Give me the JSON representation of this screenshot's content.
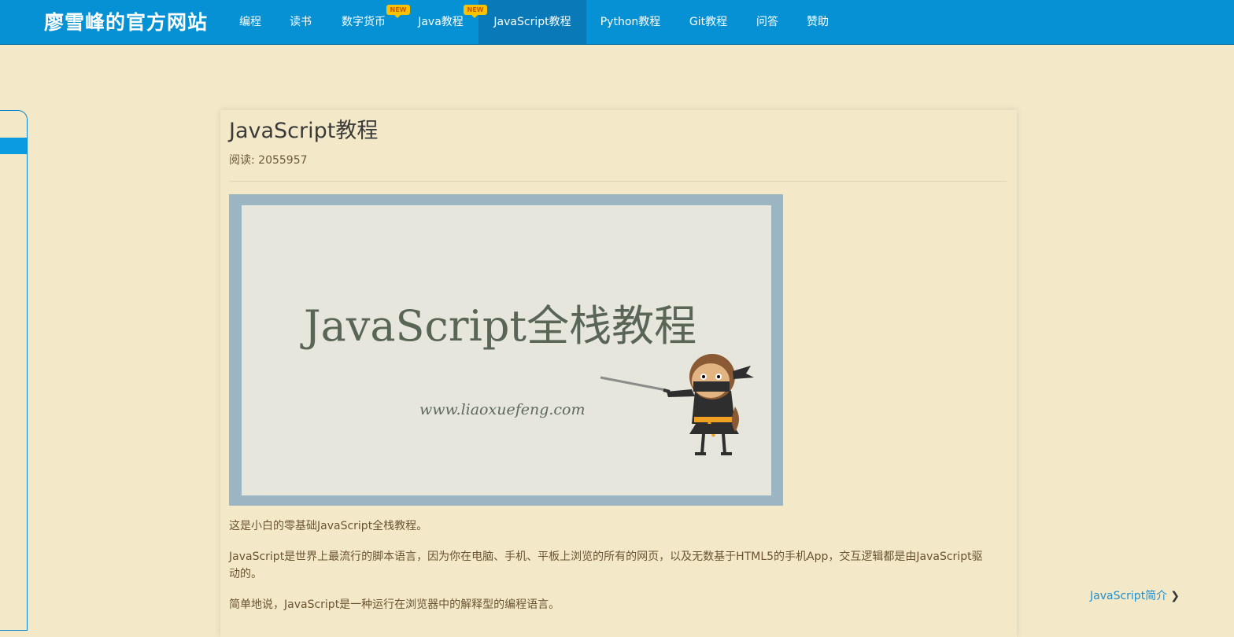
{
  "header": {
    "brand": "廖雪峰的官方网站",
    "nav": [
      {
        "label": "编程"
      },
      {
        "label": "读书"
      },
      {
        "label": "数字货币"
      },
      {
        "label": "Java教程",
        "badge": "NEW"
      },
      {
        "label": "JavaScript教程",
        "badge": "NEW"
      },
      {
        "label": "Python教程"
      },
      {
        "label": "Git教程"
      },
      {
        "label": "问答"
      },
      {
        "label": "赞助"
      }
    ]
  },
  "article": {
    "title": "JavaScript教程",
    "reads": "阅读: 2055957",
    "banner": {
      "heading": "JavaScript全栈教程",
      "url": "www.liaoxuefeng.com"
    },
    "paragraphs": [
      "这是小白的零基础JavaScript全栈教程。",
      "JavaScript是世界上最流行的脚本语言，因为你在电脑、手机、平板上浏览的所有的网页，以及无数基于HTML5的手机App，交互逻辑都是由JavaScript驱动的。",
      "简单地说，JavaScript是一种运行在浏览器中的解释型的编程语言。"
    ]
  },
  "next": {
    "label": "JavaScript简介",
    "icon": "chevron-right-icon"
  },
  "colors": {
    "header_bg": "#0591d3",
    "active_nav_bg": "#0a79b7",
    "page_bg": "#f3e9c9",
    "link": "#1e8fd0",
    "badge": "#f9c200"
  }
}
